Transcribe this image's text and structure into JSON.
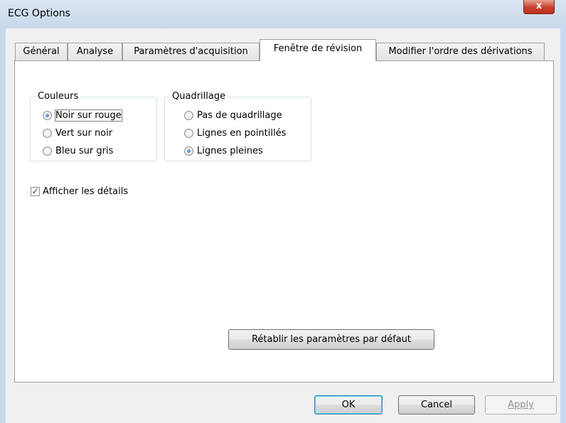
{
  "window": {
    "title": "ECG Options",
    "close_glyph": "x"
  },
  "tabs": [
    {
      "label": "Général"
    },
    {
      "label": "Analyse"
    },
    {
      "label": "Paramètres d'acquisition"
    },
    {
      "label": "Fenêtre de révision",
      "active": true
    },
    {
      "label": "Modifier l'ordre des dérivations"
    }
  ],
  "colors_group": {
    "label": "Couleurs",
    "options": [
      "Noir sur rouge",
      "Vert sur noir",
      "Bleu sur gris"
    ],
    "selected": "Noir sur rouge"
  },
  "grid_group": {
    "label": "Quadrillage",
    "options": [
      "Pas de quadrillage",
      "Lignes en pointillés",
      "Lignes pleines"
    ],
    "selected": "Lignes pleines"
  },
  "details_checkbox": {
    "label": "Afficher les détails",
    "checked": true
  },
  "reset_button": {
    "label": "Rétablir les paramètres par défaut"
  },
  "footer": {
    "ok_label": "OK",
    "cancel_label": "Cancel",
    "apply_label": "Apply",
    "apply_enabled": false
  },
  "colors": {
    "titlebar": "#c8d7eb",
    "dialog": "#f0f0f0",
    "close_button": "#c7412c"
  }
}
